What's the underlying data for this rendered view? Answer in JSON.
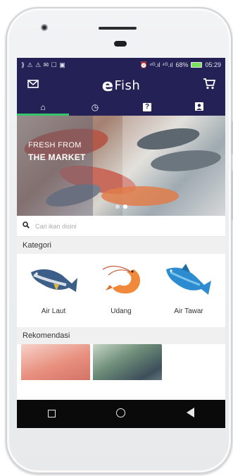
{
  "status_bar": {
    "left_icons": "⟫ ⚠ ⚠ ✉ ☐ ▣",
    "signal": "⏰ ⁴ᴳ.ıl ⁴ᴳ.ıl",
    "battery_percent": "68%",
    "time": "05:29"
  },
  "app_bar": {
    "brand_mark": "e",
    "brand_text": "Fish",
    "left_icon": "mail-icon",
    "right_icon": "cart-icon"
  },
  "tabs": [
    {
      "icon": "home-icon",
      "glyph": "⌂",
      "active": true
    },
    {
      "icon": "history-icon",
      "glyph": "◷",
      "active": false
    },
    {
      "icon": "help-icon",
      "glyph": "?",
      "active": false
    },
    {
      "icon": "profile-icon",
      "glyph": "👤",
      "active": false
    }
  ],
  "banner": {
    "line1": "FRESH FROM",
    "line2": "THE MARKET",
    "slide_count": 2,
    "active_slide": 1
  },
  "search": {
    "placeholder": "Cari ikan disini",
    "value": ""
  },
  "categories_section": {
    "title": "Kategori",
    "items": [
      {
        "label": "Air Laut",
        "icon": "tuna-fish-icon"
      },
      {
        "label": "Udang",
        "icon": "shrimp-icon"
      },
      {
        "label": "Air Tawar",
        "icon": "freshwater-fish-icon"
      }
    ]
  },
  "recommendations_section": {
    "title": "Rekomendasi"
  },
  "nav_bar": {
    "buttons": [
      "recent-apps-icon",
      "home-circle-icon",
      "back-triangle-icon"
    ]
  },
  "colors": {
    "primary": "#232155",
    "tab_indicator": "#38c46b",
    "battery": "#7be05a"
  }
}
